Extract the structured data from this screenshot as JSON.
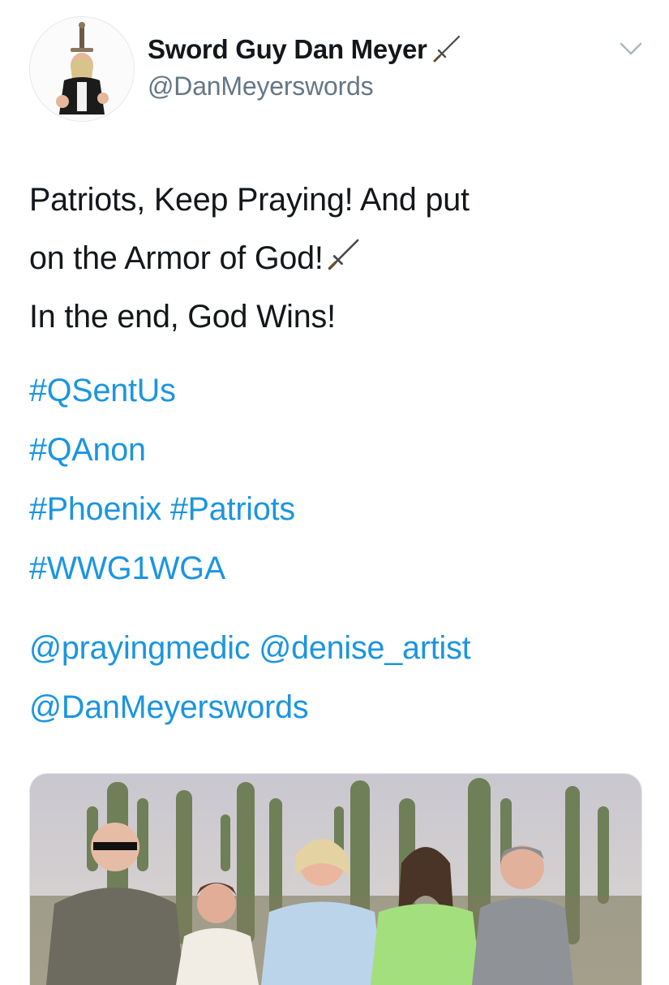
{
  "tweet": {
    "author": {
      "display_name": "Sword Guy Dan Meyer",
      "handle": "@DanMeyerswords"
    },
    "text_lines": [
      "Patriots, Keep Praying! And put",
      "on the Armor of God!",
      "In the end, God Wins!"
    ],
    "hashtag_lines": [
      "#QSentUs",
      "#QAnon",
      "#Phoenix #Patriots",
      "#WWG1WGA"
    ],
    "mention_lines": [
      "@prayingmedic @denise_artist",
      "@DanMeyerswords"
    ],
    "icons": {
      "name_emoji": "dagger-icon",
      "text_emoji": "dagger-icon",
      "menu": "chevron-down-icon"
    }
  },
  "colors": {
    "link": "#1b95e0",
    "text": "#14171a",
    "secondary": "#657786",
    "border": "#e1e8ed"
  }
}
